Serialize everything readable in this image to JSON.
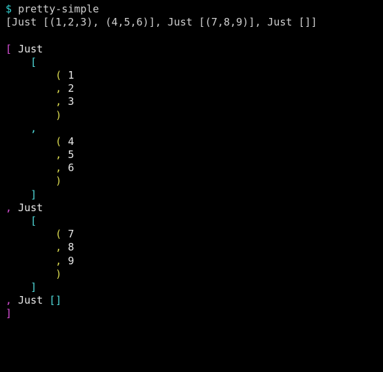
{
  "shell": {
    "prompt": "$",
    "command": "pretty-simple",
    "input_line": "[Just [(1,2,3), (4,5,6)], Just [(7,8,9)], Just []]"
  },
  "tokens": {
    "just": "Just",
    "lbracket": "[",
    "rbracket": "]",
    "lparen": "(",
    "rparen": ")",
    "comma": ",",
    "lbracket_rbracket": "[]"
  },
  "values": {
    "n1": "1",
    "n2": "2",
    "n3": "3",
    "n4": "4",
    "n5": "5",
    "n6": "6",
    "n7": "7",
    "n8": "8",
    "n9": "9"
  }
}
